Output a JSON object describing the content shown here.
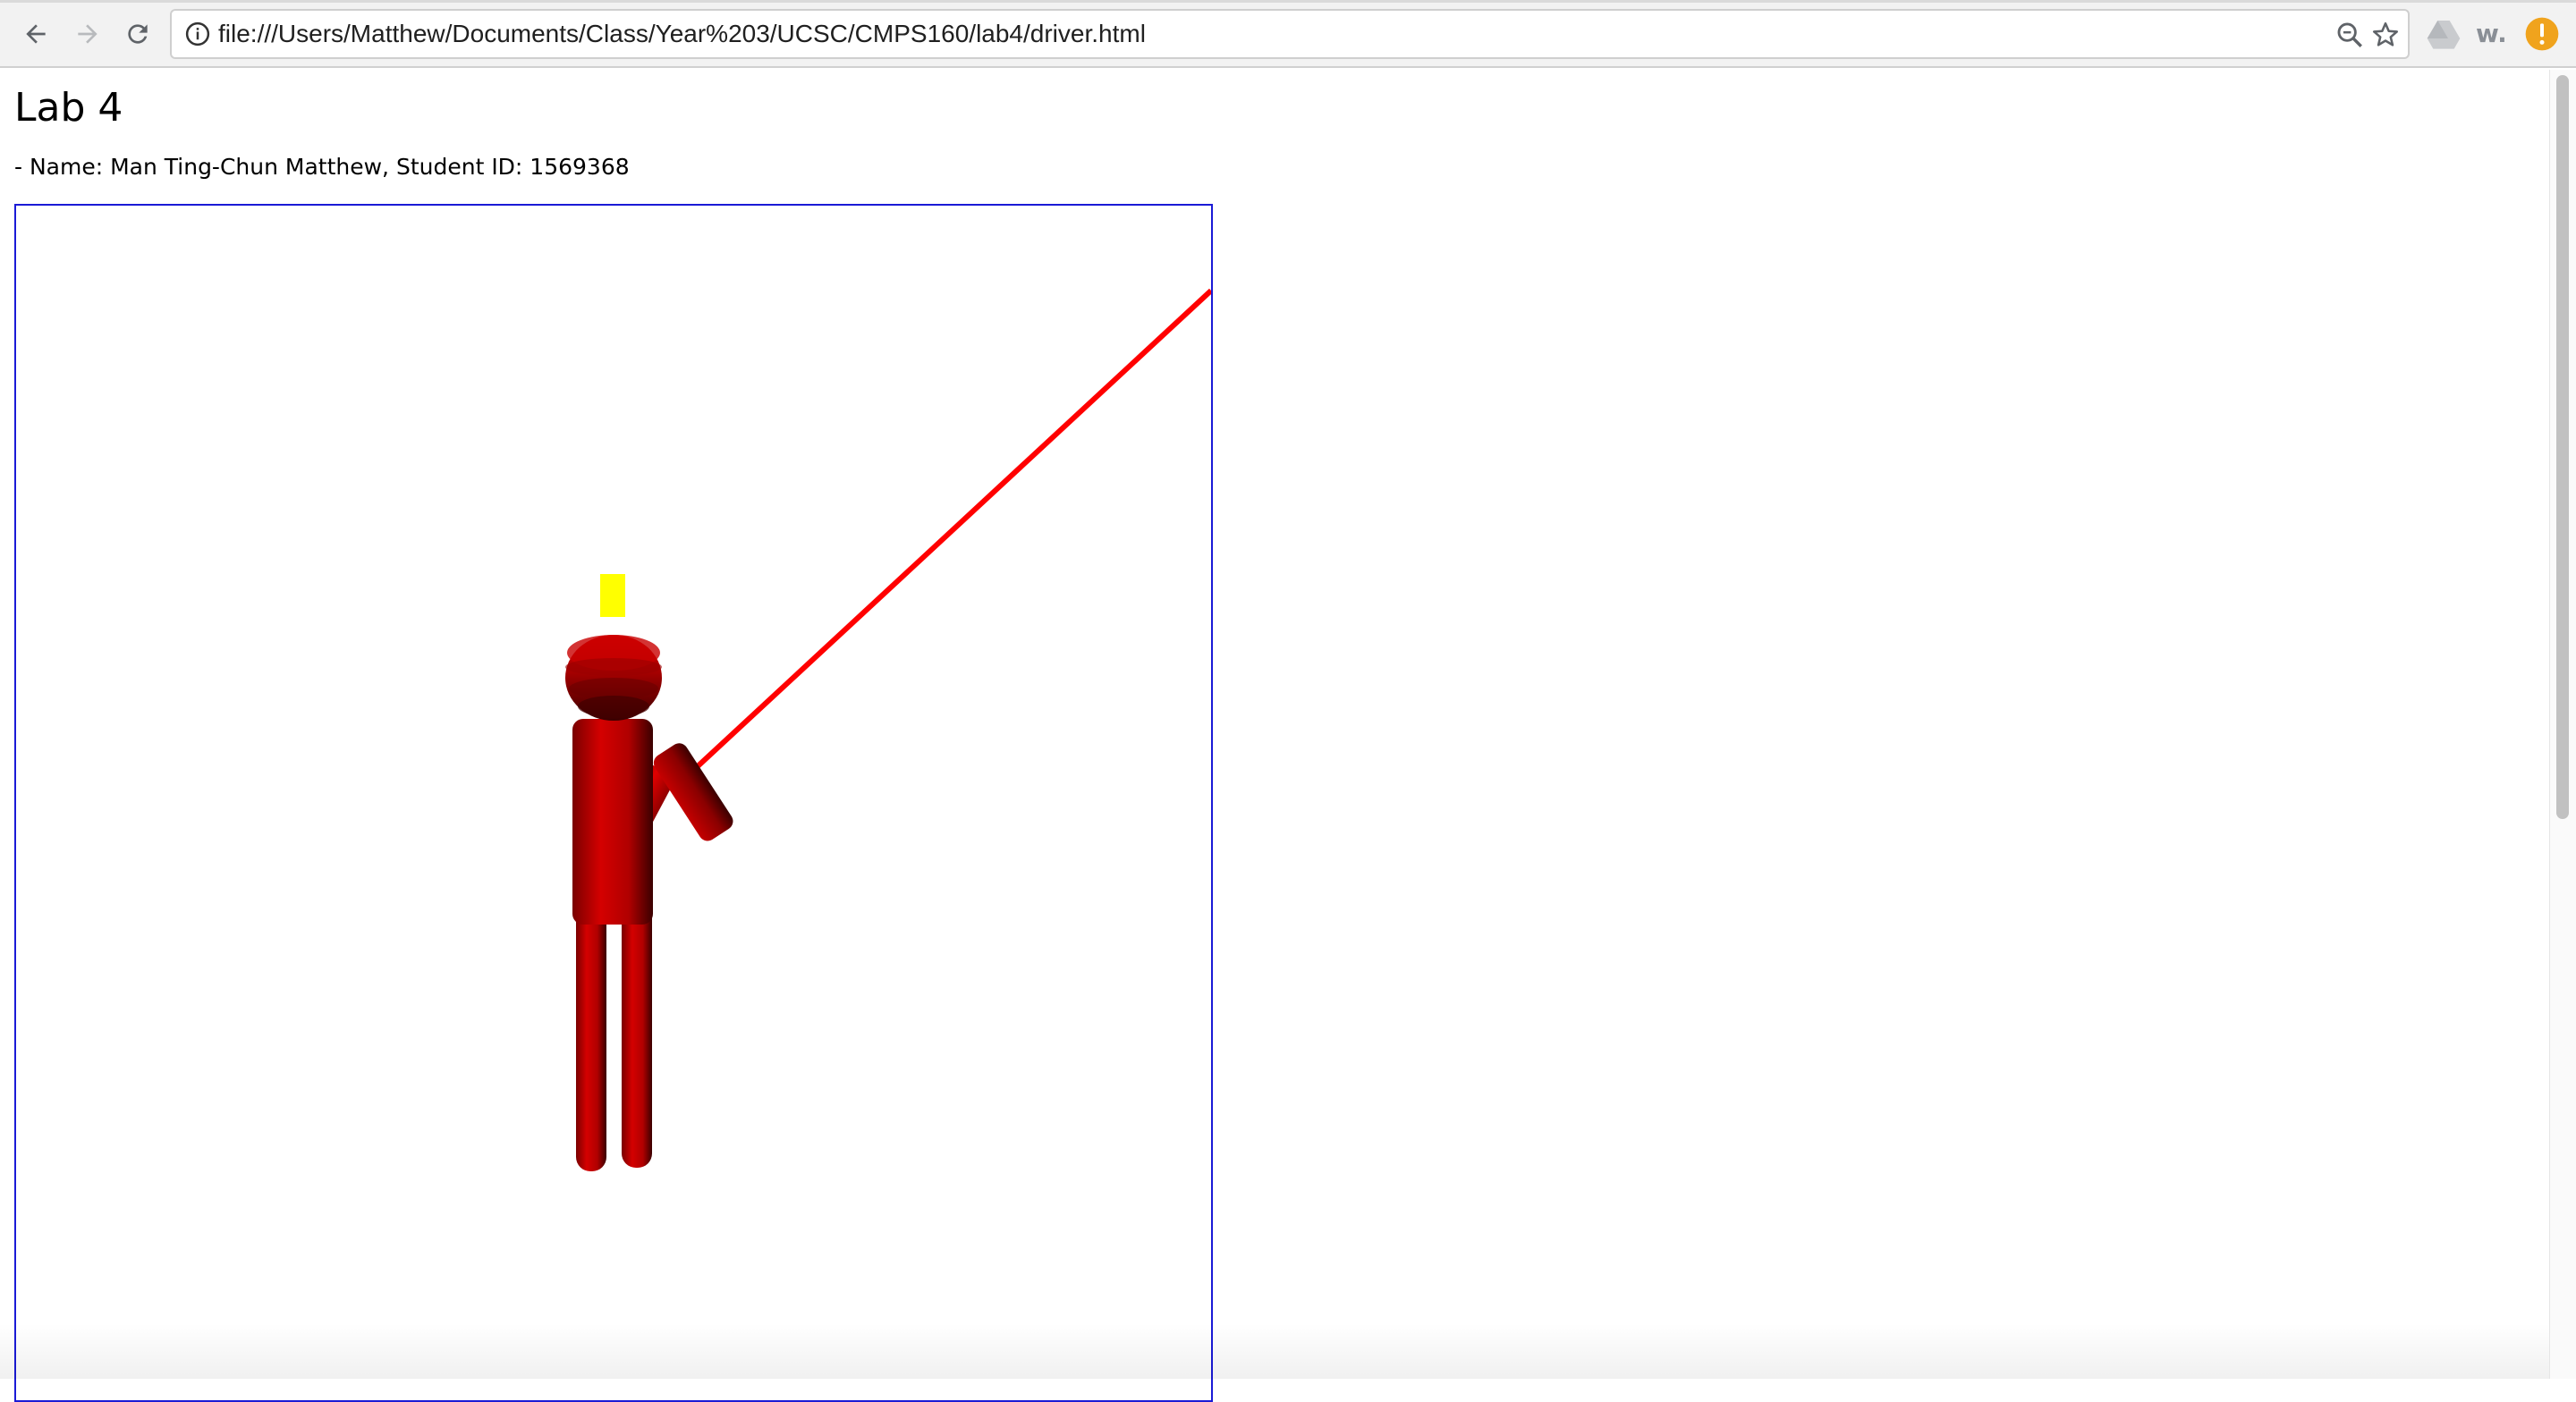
{
  "browser": {
    "url": "file:///Users/Matthew/Documents/Class/Year%203/UCSC/CMPS160/lab4/driver.html",
    "icons": {
      "back": "arrow-left-icon",
      "forward": "arrow-right-icon",
      "reload": "reload-icon",
      "page_info": "info-icon",
      "zoom": "zoom-icon",
      "bookmark": "star-icon",
      "drive_extension": "drive-icon",
      "w_extension": "w-extension-icon",
      "alert": "alert-icon"
    },
    "w_extension_label": "w."
  },
  "page": {
    "title": "Lab 4",
    "student_info": "- Name: Man Ting-Chun Matthew, Student ID: 1569368"
  },
  "scene": {
    "canvas_border_color": "#1a1ad6",
    "figure_color": "#e00000",
    "light_marker_color": "#ffff00",
    "line_color": "#ff0000"
  }
}
